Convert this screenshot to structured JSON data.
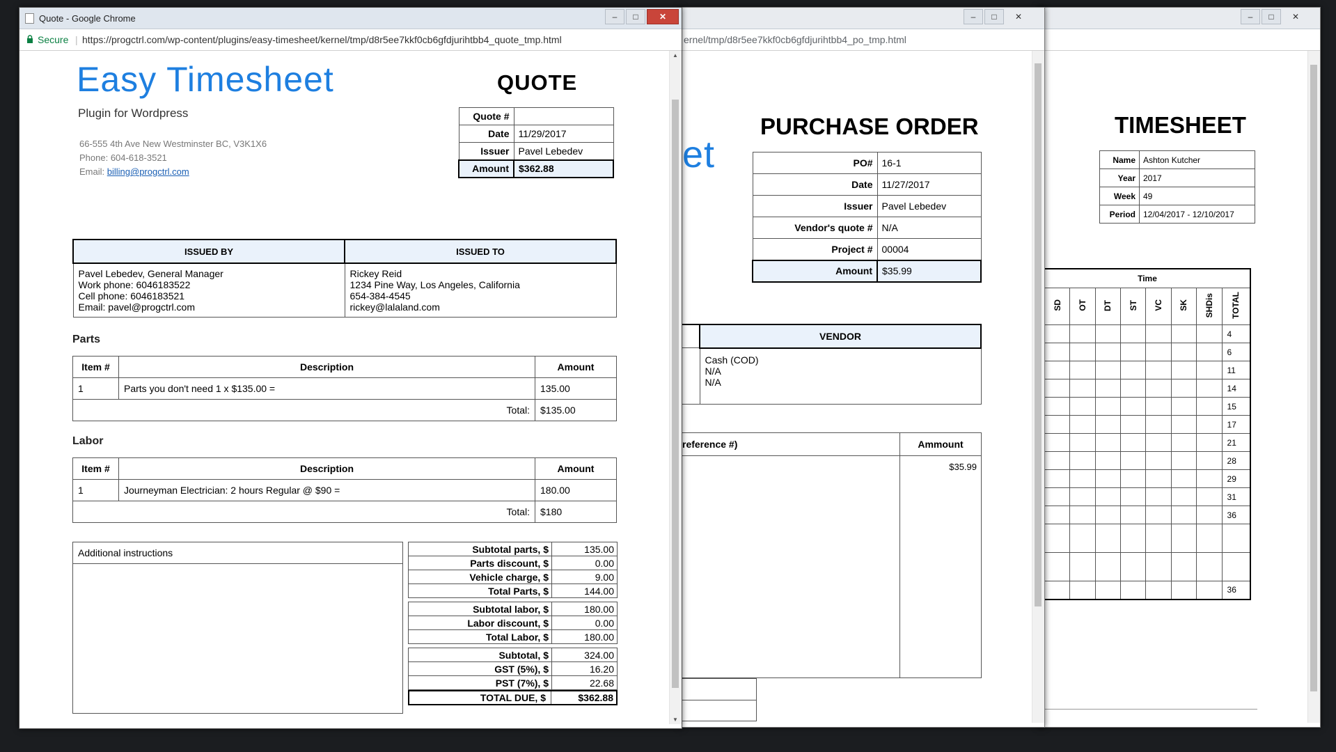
{
  "timesheet_window": {
    "title": "TIMESHEET",
    "fields": [
      {
        "label": "Name",
        "value": "Ashton Kutcher"
      },
      {
        "label": "Year",
        "value": "2017"
      },
      {
        "label": "Week",
        "value": "49"
      },
      {
        "label": "Period",
        "value": "12/04/2017 - 12/10/2017"
      }
    ],
    "time_header": "Time",
    "columns": [
      "SD",
      "OT",
      "DT",
      "ST",
      "VC",
      "SK",
      "SHDis",
      "TOTAL"
    ],
    "totals": [
      "4",
      "6",
      "11",
      "14",
      "15",
      "17",
      "21",
      "28",
      "29",
      "31",
      "36",
      "",
      "",
      "36"
    ]
  },
  "po_window": {
    "url_tail": "ernel/tmp/d8r5ee7kkf0cb6gfdjurihtbb4_po_tmp.html",
    "logo_fragment": "et",
    "title": "PURCHASE ORDER",
    "fields": [
      {
        "label": "PO#",
        "value": "16-1"
      },
      {
        "label": "Date",
        "value": "11/27/2017"
      },
      {
        "label": "Issuer",
        "value": "Pavel Lebedev"
      },
      {
        "label": "Vendor's quote #",
        "value": "N/A"
      },
      {
        "label": "Project #",
        "value": "00004"
      },
      {
        "label": "Amount",
        "value": "$35.99"
      }
    ],
    "vendor_header": "VENDOR",
    "vendor_lines": [
      "Cash (COD)",
      "N/A",
      "N/A"
    ],
    "ref_header": "reference #)",
    "ammount_header": "Ammount",
    "ammount_value": "$35.99"
  },
  "quote_window": {
    "window_title": "Quote - Google Chrome",
    "secure_label": "Secure",
    "url": "https://progctrl.com/wp-content/plugins/easy-timesheet/kernel/tmp/d8r5ee7kkf0cb6gfdjurihtbb4_quote_tmp.html",
    "logo_text": "Easy Timesheet",
    "logo_sub": "Plugin for Wordpress",
    "company_address": "66-555 4th Ave New Westminster BC, V3K1X6",
    "company_phone": "Phone: 604-618-3521",
    "company_email_label": "Email:",
    "company_email": "billing@progctrl.com",
    "doc_title": "QUOTE",
    "fields": [
      {
        "label": "Quote #",
        "value": ""
      },
      {
        "label": "Date",
        "value": "11/29/2017"
      },
      {
        "label": "Issuer",
        "value": "Pavel Lebedev"
      },
      {
        "label": "Amount",
        "value": "$362.88"
      }
    ],
    "issued_by_header": "ISSUED BY",
    "issued_to_header": "ISSUED TO",
    "issued_by": [
      "Pavel Lebedev, General Manager",
      "Work phone: 6046183522",
      "Cell phone: 6046183521",
      "Email: pavel@progctrl.com"
    ],
    "issued_to": [
      "Rickey Reid",
      "1234 Pine Way, Los Angeles, California",
      "654-384-4545",
      "rickey@lalaland.com"
    ],
    "parts_title": "Parts",
    "labor_title": "Labor",
    "col_item": "Item #",
    "col_desc": "Description",
    "col_amount": "Amount",
    "total_label": "Total:",
    "parts_row": {
      "item": "1",
      "desc": "Parts you don't need 1 x $135.00 =",
      "amount": "135.00"
    },
    "parts_total": "$135.00",
    "labor_row": {
      "item": "1",
      "desc": "Journeyman Electrician: 2 hours Regular @ $90 =",
      "amount": "180.00"
    },
    "labor_total": "$180",
    "additional_label": "Additional instructions",
    "summary_group1": [
      {
        "label": "Subtotal parts, $",
        "value": "135.00"
      },
      {
        "label": "Parts discount, $",
        "value": "0.00"
      },
      {
        "label": "Vehicle charge, $",
        "value": "9.00"
      },
      {
        "label": "Total Parts, $",
        "value": "144.00"
      }
    ],
    "summary_group2": [
      {
        "label": "Subtotal labor, $",
        "value": "180.00"
      },
      {
        "label": "Labor discount, $",
        "value": "0.00"
      },
      {
        "label": "Total Labor, $",
        "value": "180.00"
      }
    ],
    "summary_group3": [
      {
        "label": "Subtotal, $",
        "value": "324.00"
      },
      {
        "label": "GST (5%), $",
        "value": "16.20"
      },
      {
        "label": "PST (7%), $",
        "value": "22.68"
      }
    ],
    "total_due_label": "TOTAL DUE, $",
    "total_due_value": "$362.88"
  },
  "colors": {
    "logo_blue": "#1e7fe0",
    "highlight": "#eaf2fb",
    "close_red": "#c9453a"
  }
}
